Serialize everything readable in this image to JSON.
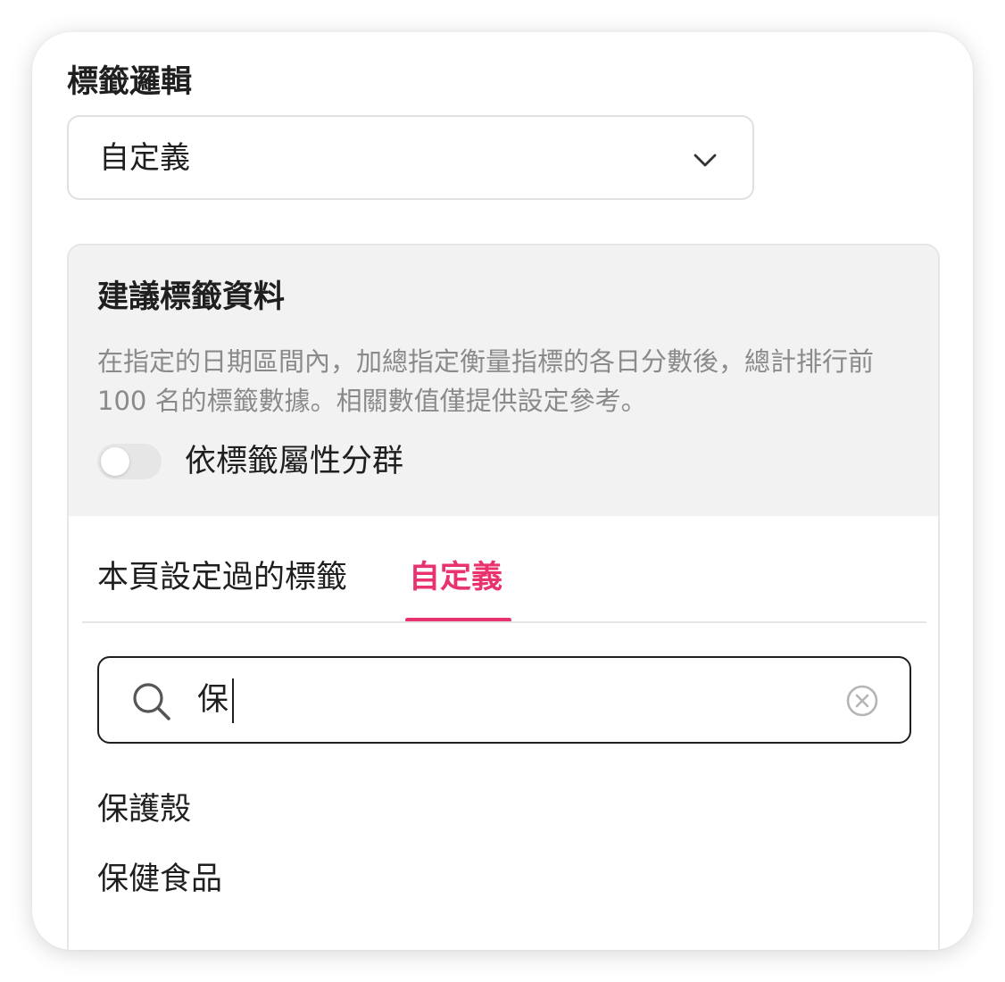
{
  "field": {
    "label": "標籤邏輯",
    "select_value": "自定義",
    "select_icon": "chevron-down-icon"
  },
  "suggest_panel": {
    "title": "建議標籤資料",
    "description": "在指定的日期區間內，加總指定衡量指標的各日分數後，總計排行前 100 名的標籤數據。相關數值僅提供設定參考。",
    "toggle_label": "依標籤屬性分群",
    "toggle_on": false
  },
  "tabs": [
    {
      "label": "本頁設定過的標籤",
      "active": false
    },
    {
      "label": "自定義",
      "active": true
    }
  ],
  "search": {
    "value": "保",
    "icon": "search-icon",
    "clear_icon": "clear-circle-icon"
  },
  "results": [
    {
      "label": "保護殼"
    },
    {
      "label": "保健食品"
    }
  ],
  "colors": {
    "accent": "#e9336e",
    "text": "#1f1f1f",
    "muted": "#8a8a8a",
    "panel_bg": "#f2f2f2",
    "border": "#e0e0e0"
  }
}
